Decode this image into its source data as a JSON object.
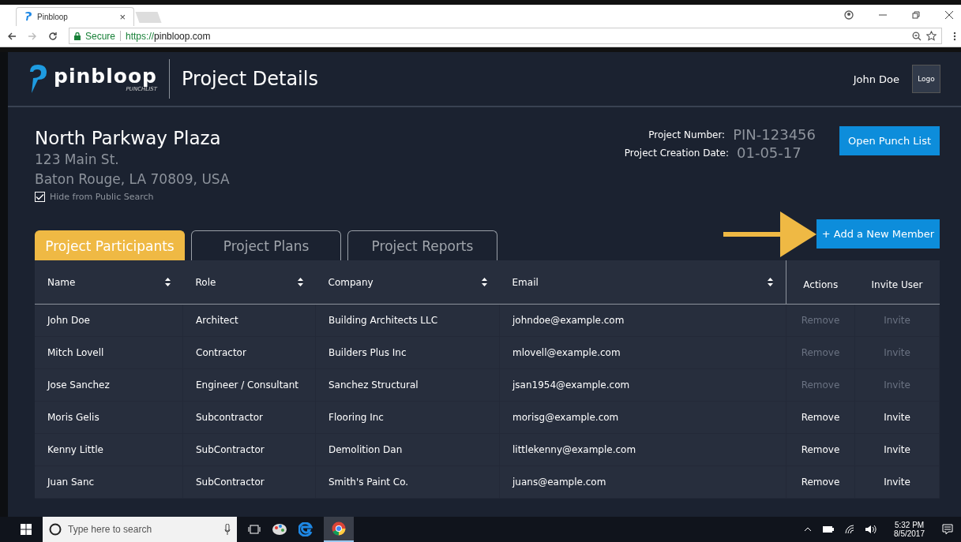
{
  "browser": {
    "tab_title": "Pinbloop",
    "tab_close": "×",
    "secure_label": "Secure",
    "url_scheme": "https://",
    "url_host": "pinbloop.com"
  },
  "header": {
    "brand": "pinbloop",
    "brand_sub": "PUNCHLIST",
    "title": "Project Details",
    "user": "John Doe",
    "avatar_label": "Logo"
  },
  "project": {
    "name": "North Parkway Plaza",
    "address_line1": "123 Main St.",
    "address_line2": "Baton Rouge, LA 70809, USA",
    "hide_label": "Hide from Public Search",
    "hide_checked": true,
    "number_label": "Project Number:",
    "number": "PIN-123456",
    "date_label": "Project Creation Date:",
    "date": "01-05-17",
    "open_button": "Open Punch List"
  },
  "tabs": [
    {
      "label": "Project Participants",
      "selected": true
    },
    {
      "label": "Project Plans",
      "selected": false
    },
    {
      "label": "Project Reports",
      "selected": false
    }
  ],
  "add_button": "+ Add a New Member",
  "table": {
    "columns": [
      {
        "label": "Name",
        "sortable": true
      },
      {
        "label": "Role",
        "sortable": true
      },
      {
        "label": "Company",
        "sortable": true
      },
      {
        "label": "Email",
        "sortable": true
      },
      {
        "label": "Actions",
        "sortable": false
      },
      {
        "label": "Invite User",
        "sortable": false
      }
    ],
    "rows": [
      {
        "name": "John Doe",
        "role": "Architect",
        "company": "Building Architects LLC",
        "email": "johndoe@example.com",
        "remove": "Remove",
        "invite": "Invite",
        "disabled": true
      },
      {
        "name": "Mitch Lovell",
        "role": "Contractor",
        "company": "Builders Plus Inc",
        "email": "mlovell@example.com",
        "remove": "Remove",
        "invite": "Invite",
        "disabled": true
      },
      {
        "name": "Jose Sanchez",
        "role": "Engineer / Consultant",
        "company": "Sanchez Structural",
        "email": "jsan1954@example.com",
        "remove": "Remove",
        "invite": "Invite",
        "disabled": true
      },
      {
        "name": "Moris Gelis",
        "role": "Subcontractor",
        "company": "Flooring Inc",
        "email": "morisg@example.com",
        "remove": "Remove",
        "invite": "Invite",
        "disabled": false
      },
      {
        "name": "Kenny Little",
        "role": "SubContractor",
        "company": "Demolition Dan",
        "email": "littlekenny@example.com",
        "remove": "Remove",
        "invite": "Invite",
        "disabled": false
      },
      {
        "name": "Juan Sanc",
        "role": "SubContractor",
        "company": "Smith's Paint Co.",
        "email": "juans@eample.com",
        "remove": "Remove",
        "invite": "Invite",
        "disabled": false
      }
    ]
  },
  "taskbar": {
    "search_placeholder": "Type here to search",
    "time": "5:32 PM",
    "date": "8/5/2017"
  }
}
